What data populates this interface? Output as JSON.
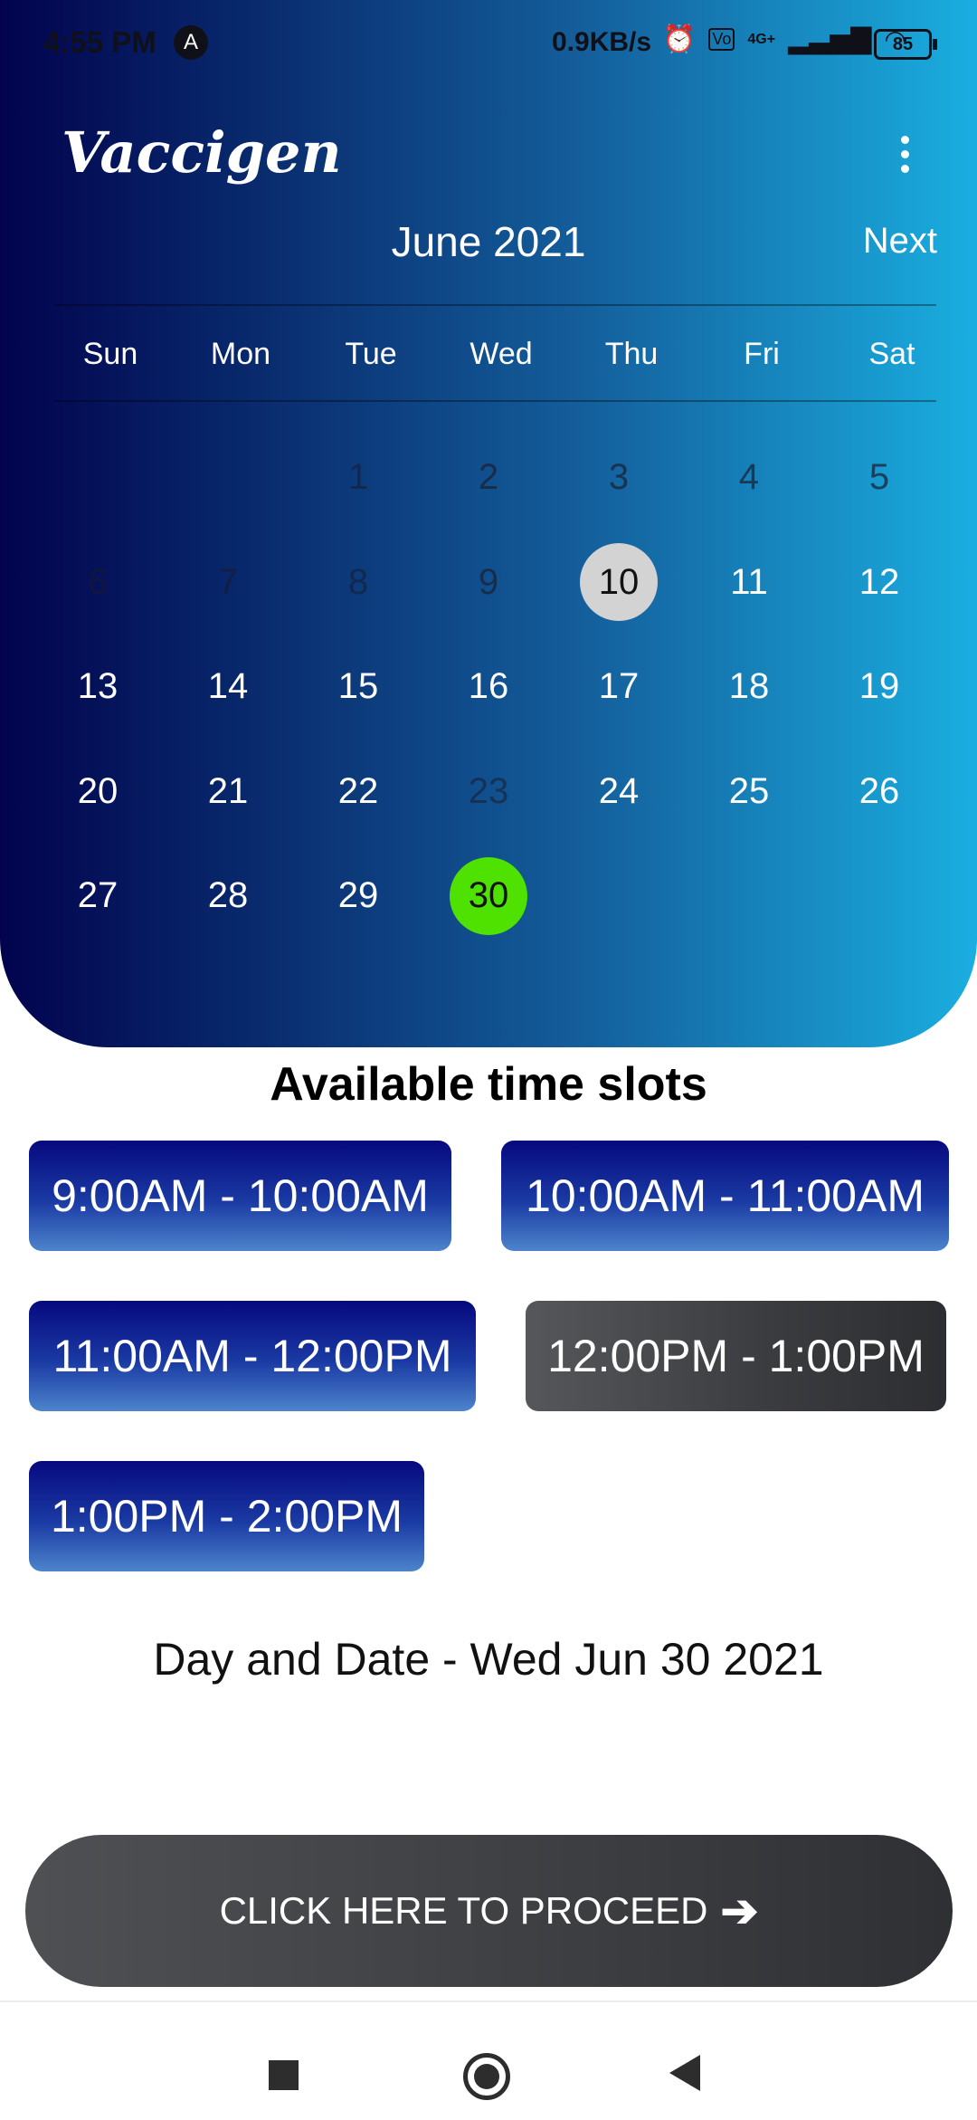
{
  "status_bar": {
    "time": "4:55 PM",
    "speed": "0.9KB/s",
    "network": "4G+",
    "battery": "85"
  },
  "app": {
    "title": "Vaccigen"
  },
  "calendar": {
    "month_label": "June 2021",
    "next_label": "Next",
    "weekdays": [
      "Sun",
      "Mon",
      "Tue",
      "Wed",
      "Thu",
      "Fri",
      "Sat"
    ],
    "days": [
      {
        "label": "",
        "state": "empty"
      },
      {
        "label": "",
        "state": "empty"
      },
      {
        "label": "1",
        "state": "disabled"
      },
      {
        "label": "2",
        "state": "dim"
      },
      {
        "label": "3",
        "state": "dim"
      },
      {
        "label": "4",
        "state": "dim"
      },
      {
        "label": "5",
        "state": "dim"
      },
      {
        "label": "6",
        "state": "disabled"
      },
      {
        "label": "7",
        "state": "disabled"
      },
      {
        "label": "8",
        "state": "disabled"
      },
      {
        "label": "9",
        "state": "dim"
      },
      {
        "label": "10",
        "state": "today"
      },
      {
        "label": "11",
        "state": "normal"
      },
      {
        "label": "12",
        "state": "normal"
      },
      {
        "label": "13",
        "state": "normal"
      },
      {
        "label": "14",
        "state": "normal"
      },
      {
        "label": "15",
        "state": "normal"
      },
      {
        "label": "16",
        "state": "normal"
      },
      {
        "label": "17",
        "state": "normal"
      },
      {
        "label": "18",
        "state": "normal"
      },
      {
        "label": "19",
        "state": "normal"
      },
      {
        "label": "20",
        "state": "normal"
      },
      {
        "label": "21",
        "state": "normal"
      },
      {
        "label": "22",
        "state": "normal"
      },
      {
        "label": "23",
        "state": "disabled"
      },
      {
        "label": "24",
        "state": "normal"
      },
      {
        "label": "25",
        "state": "normal"
      },
      {
        "label": "26",
        "state": "normal"
      },
      {
        "label": "27",
        "state": "normal"
      },
      {
        "label": "28",
        "state": "normal"
      },
      {
        "label": "29",
        "state": "normal"
      },
      {
        "label": "30",
        "state": "selected"
      }
    ]
  },
  "slots": {
    "title": "Available time slots",
    "items": [
      {
        "label": "9:00AM - 10:00AM",
        "state": "available"
      },
      {
        "label": "10:00AM - 11:00AM",
        "state": "available"
      },
      {
        "label": "11:00AM - 12:00PM",
        "state": "available"
      },
      {
        "label": "12:00PM - 1:00PM",
        "state": "booked"
      },
      {
        "label": "1:00PM - 2:00PM",
        "state": "available"
      }
    ]
  },
  "selection": {
    "day_and_date": "Day and Date - Wed Jun 30 2021"
  },
  "proceed": {
    "label": "CLICK HERE TO PROCEED",
    "arrow": "➔"
  },
  "colors": {
    "selected_day": "#4fe100",
    "today_day": "#d3d3d3",
    "slot_available": "#06097e",
    "slot_booked": "#3a3b3e"
  }
}
